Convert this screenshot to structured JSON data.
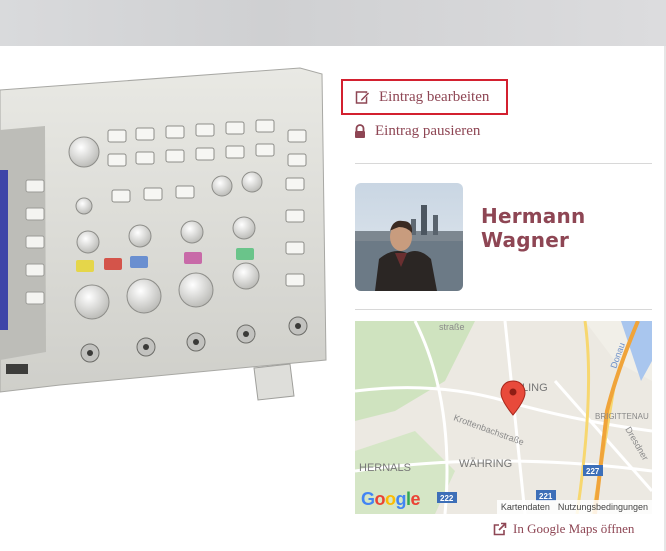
{
  "actions": {
    "edit_label": "Eintrag bearbeiten",
    "pause_label": "Eintrag pausieren"
  },
  "profile": {
    "name": "Hermann Wagner"
  },
  "map": {
    "labels": {
      "street_top": "straße",
      "district_ling": "LING",
      "street_krotten": "Krottenbachstraße",
      "district_hernals": "HERNALS",
      "district_waehring": "WÄHRING",
      "brigittenau": "BRIGITTENAU",
      "dresdner": "Dresdner",
      "donau": "Donau",
      "route_227": "227",
      "route_222": "222",
      "route_221": "221"
    },
    "logo": "Google",
    "footer_data": "Kartendaten",
    "footer_terms": "Nutzungsbedingungen",
    "open_link": "In Google Maps öffnen"
  },
  "colors": {
    "accent": "#8e4654",
    "highlight_border": "#d3202f"
  }
}
